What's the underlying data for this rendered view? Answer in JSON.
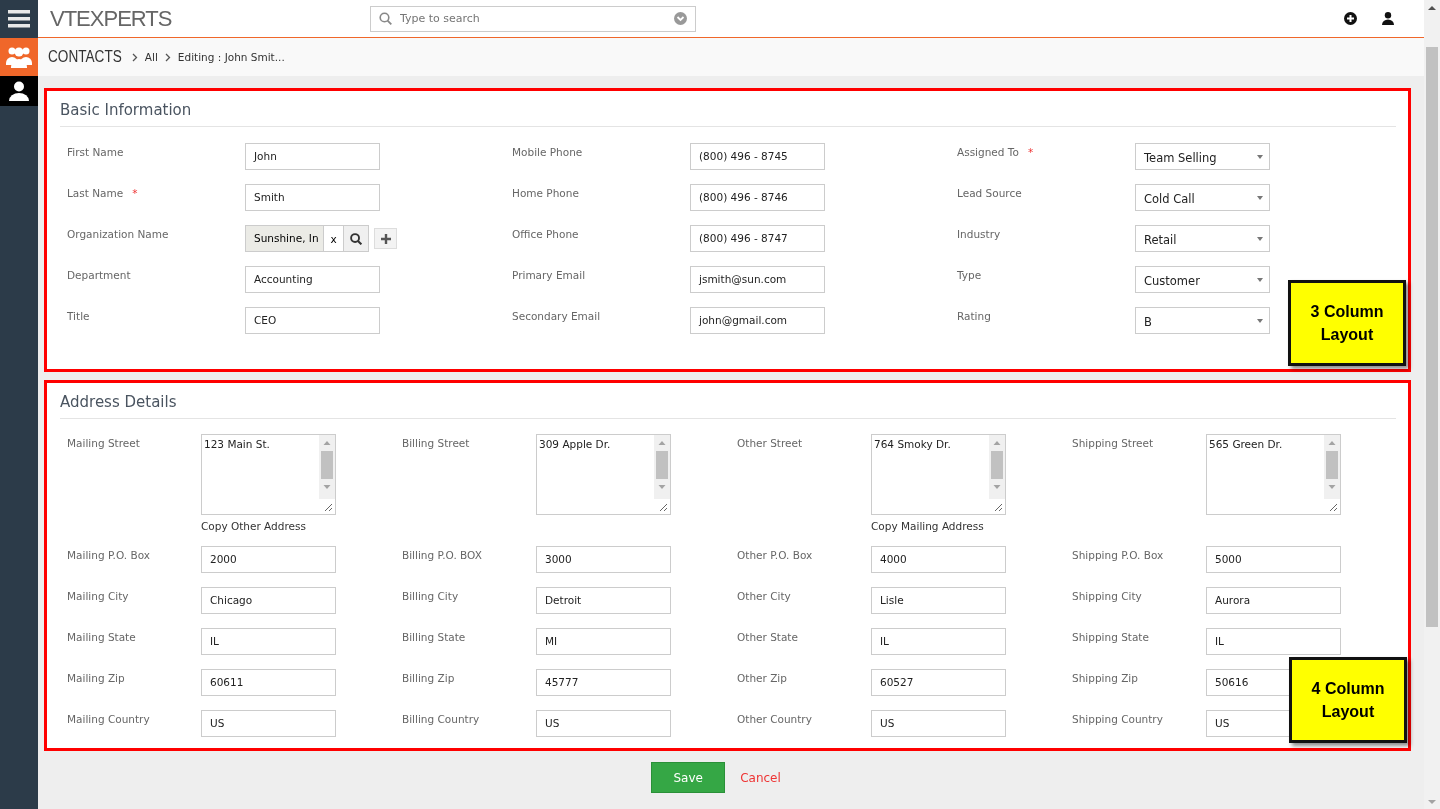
{
  "header": {
    "logo": "VTEXPERTS",
    "search": {
      "placeholder": "Type to search"
    }
  },
  "breadcrumb": {
    "module": "CONTACTS",
    "items": [
      "All",
      "Editing : John Smit..."
    ]
  },
  "sections": [
    {
      "title": "Basic Information",
      "kind": "three-column",
      "callout": "3 Column Layout",
      "fields": [
        {
          "label": "First Name",
          "kind": "text",
          "value": "John"
        },
        {
          "label": "Mobile Phone",
          "kind": "text",
          "value": "(800) 496 - 8745"
        },
        {
          "label": "Assigned To",
          "marker": "*",
          "kind": "select",
          "value": "Team Selling"
        },
        {
          "label": "Last Name",
          "marker": "*",
          "kind": "text",
          "value": "Smith"
        },
        {
          "label": "Home Phone",
          "kind": "text",
          "value": "(800) 496 - 8746"
        },
        {
          "label": "Lead Source",
          "kind": "select",
          "value": "Cold Call"
        },
        {
          "label": "Organization Name",
          "kind": "reference",
          "value": "Sunshine, In",
          "clear": "x"
        },
        {
          "label": "Office Phone",
          "kind": "text",
          "value": "(800) 496 - 8747"
        },
        {
          "label": "Industry",
          "kind": "select",
          "value": "Retail"
        },
        {
          "label": "Department",
          "kind": "text",
          "value": "Accounting"
        },
        {
          "label": "Primary Email",
          "kind": "text",
          "value": "jsmith@sun.com"
        },
        {
          "label": "Type",
          "kind": "select",
          "value": "Customer"
        },
        {
          "label": "Title",
          "kind": "text",
          "value": "CEO"
        },
        {
          "label": "Secondary Email",
          "kind": "text",
          "value": "john@gmail.com"
        },
        {
          "label": "Rating",
          "kind": "select",
          "value": "B"
        }
      ]
    },
    {
      "title": "Address Details",
      "kind": "four-column",
      "callout": "4 Column Layout",
      "fields": [
        {
          "label": "Mailing Street",
          "kind": "textarea",
          "value": "123 Main St.",
          "link": "Copy Other Address"
        },
        {
          "label": "Billing Street",
          "kind": "textarea",
          "value": "309 Apple Dr."
        },
        {
          "label": "Other Street",
          "kind": "textarea",
          "value": "764 Smoky Dr.",
          "link": "Copy Mailing Address"
        },
        {
          "label": "Shipping Street",
          "kind": "textarea",
          "value": "565 Green Dr."
        },
        {
          "label": "Mailing P.O. Box",
          "kind": "text",
          "value": "2000"
        },
        {
          "label": "Billing P.O. BOX",
          "kind": "text",
          "value": "3000"
        },
        {
          "label": "Other P.O. Box",
          "kind": "text",
          "value": "4000"
        },
        {
          "label": "Shipping P.O. Box",
          "kind": "text",
          "value": "5000"
        },
        {
          "label": "Mailing City",
          "kind": "text",
          "value": "Chicago"
        },
        {
          "label": "Billing City",
          "kind": "text",
          "value": "Detroit"
        },
        {
          "label": "Other City",
          "kind": "text",
          "value": "Lisle"
        },
        {
          "label": "Shipping City",
          "kind": "text",
          "value": "Aurora"
        },
        {
          "label": "Mailing State",
          "kind": "text",
          "value": "IL"
        },
        {
          "label": "Billing State",
          "kind": "text",
          "value": "MI"
        },
        {
          "label": "Other State",
          "kind": "text",
          "value": "IL"
        },
        {
          "label": "Shipping State",
          "kind": "text",
          "value": "IL"
        },
        {
          "label": "Mailing Zip",
          "kind": "text",
          "value": "60611"
        },
        {
          "label": "Billing Zip",
          "kind": "text",
          "value": "45777"
        },
        {
          "label": "Other Zip",
          "kind": "text",
          "value": "60527"
        },
        {
          "label": "Shipping Zip",
          "kind": "text",
          "value": "50616"
        },
        {
          "label": "Mailing Country",
          "kind": "text",
          "value": "US"
        },
        {
          "label": "Billing Country",
          "kind": "text",
          "value": "US"
        },
        {
          "label": "Other Country",
          "kind": "text",
          "value": "US"
        },
        {
          "label": "Shipping Country",
          "kind": "text",
          "value": "US"
        }
      ]
    }
  ],
  "footer": {
    "save": "Save",
    "cancel": "Cancel"
  }
}
